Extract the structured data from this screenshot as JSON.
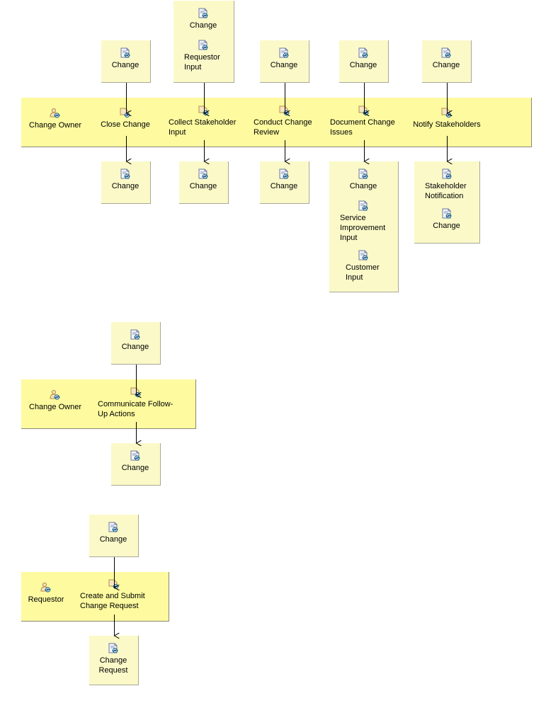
{
  "colors": {
    "lane": "#fdfa9f",
    "artifact": "#fbf9c8",
    "arrow": "#000000"
  },
  "diagrams": [
    {
      "role": {
        "label": "Change Owner",
        "icon": "role-icon"
      },
      "tasks": [
        {
          "label": "Close Change",
          "icon": "task-icon",
          "inputs": [
            {
              "label": "Change"
            }
          ],
          "outputs": [
            {
              "label": "Change"
            }
          ]
        },
        {
          "label": "Collect Stakeholder\nInput",
          "icon": "task-icon",
          "inputs": [
            {
              "label": "Change"
            },
            {
              "label": "Requestor\nInput"
            }
          ],
          "outputs": [
            {
              "label": "Change"
            }
          ]
        },
        {
          "label": "Conduct Change\nReview",
          "icon": "task-icon",
          "inputs": [
            {
              "label": "Change"
            }
          ],
          "outputs": [
            {
              "label": "Change"
            }
          ]
        },
        {
          "label": "Document Change\nIssues",
          "icon": "task-icon",
          "inputs": [
            {
              "label": "Change"
            }
          ],
          "outputs": [
            {
              "label": "Change"
            },
            {
              "label": "Service\nImprovement\nInput"
            },
            {
              "label": "Customer\nInput"
            }
          ]
        },
        {
          "label": "Notify Stakeholders",
          "icon": "task-icon",
          "inputs": [
            {
              "label": "Change"
            }
          ],
          "outputs": [
            {
              "label": "Stakeholder\nNotification"
            },
            {
              "label": "Change"
            }
          ]
        }
      ]
    },
    {
      "role": {
        "label": "Change Owner",
        "icon": "role-icon"
      },
      "tasks": [
        {
          "label": "Communicate Follow-\nUp Actions",
          "icon": "task-icon",
          "inputs": [
            {
              "label": "Change"
            }
          ],
          "outputs": [
            {
              "label": "Change"
            }
          ]
        }
      ]
    },
    {
      "role": {
        "label": "Requestor",
        "icon": "role-icon"
      },
      "tasks": [
        {
          "label": "Create and Submit\nChange Request",
          "icon": "task-icon",
          "inputs": [
            {
              "label": "Change"
            }
          ],
          "outputs": [
            {
              "label": "Change\nRequest"
            }
          ]
        }
      ]
    }
  ]
}
